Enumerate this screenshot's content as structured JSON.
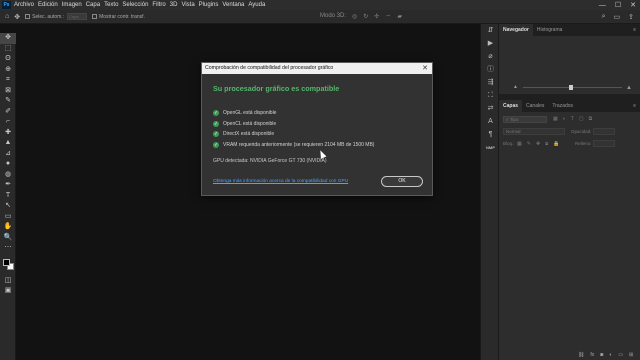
{
  "app": {
    "logo_text": "Ps"
  },
  "menu": [
    "Archivo",
    "Edición",
    "Imagen",
    "Capa",
    "Texto",
    "Selección",
    "Filtro",
    "3D",
    "Vista",
    "Plugins",
    "Ventana",
    "Ayuda"
  ],
  "window_controls": {
    "minimize": "—",
    "maximize": "☐",
    "close": "✕"
  },
  "options_bar": {
    "auto_select_label": "Selec. autom.:",
    "auto_select_value": "Capa",
    "transform_controls_label": "Mostrar contr. transf.",
    "mode_3d_label": "Modo 3D:"
  },
  "tools": [
    "✥",
    "⬚",
    "ʘ",
    "⊕",
    "⌗",
    "⊠",
    "✎",
    "✐",
    "⌐",
    "✚",
    "▲",
    "⊿",
    "●",
    "◍",
    "✒",
    "T",
    "↖",
    "▭",
    "✋",
    "🔍",
    "⋯"
  ],
  "icon_strip": [
    "⇵",
    "▶",
    "⌀",
    "ⓘ",
    "⇶",
    "⛶",
    "⇄",
    "A",
    "¶",
    "NMP"
  ],
  "right_panel": {
    "top_tabs": {
      "active": "Navegador",
      "other": "Histograma",
      "menu": "≡"
    },
    "layer_tabs": [
      "Capas",
      "Canales",
      "Trazados"
    ],
    "layers": {
      "search_placeholder": "Tipo",
      "blend_mode": "Normal",
      "opacity_label": "Opacidad:",
      "lock_label": "Bloq.:",
      "fill_label": "Relleno:"
    }
  },
  "dialog": {
    "title": "Comprobación de compatibilidad del procesador gráfico",
    "heading": "Su procesador gráfico es compatible",
    "checks": [
      "OpenGL está disponible",
      "OpenCL está disponible",
      "DirectX está disponible",
      "VRAM requerida anteriormente (se requieren 2104 MB de 1500 MB)"
    ],
    "gpu_detected": "GPU detectada: NVIDIA GeForce GT 730 (NVIDIA)",
    "link": "Obtenga más información acerca de la compatibilidad con GPU",
    "ok_label": "OK",
    "close_glyph": "✕"
  },
  "colors": {
    "accent_green": "#55b56b",
    "link_blue": "#4ea1ff",
    "check_green": "#3d9b57"
  }
}
